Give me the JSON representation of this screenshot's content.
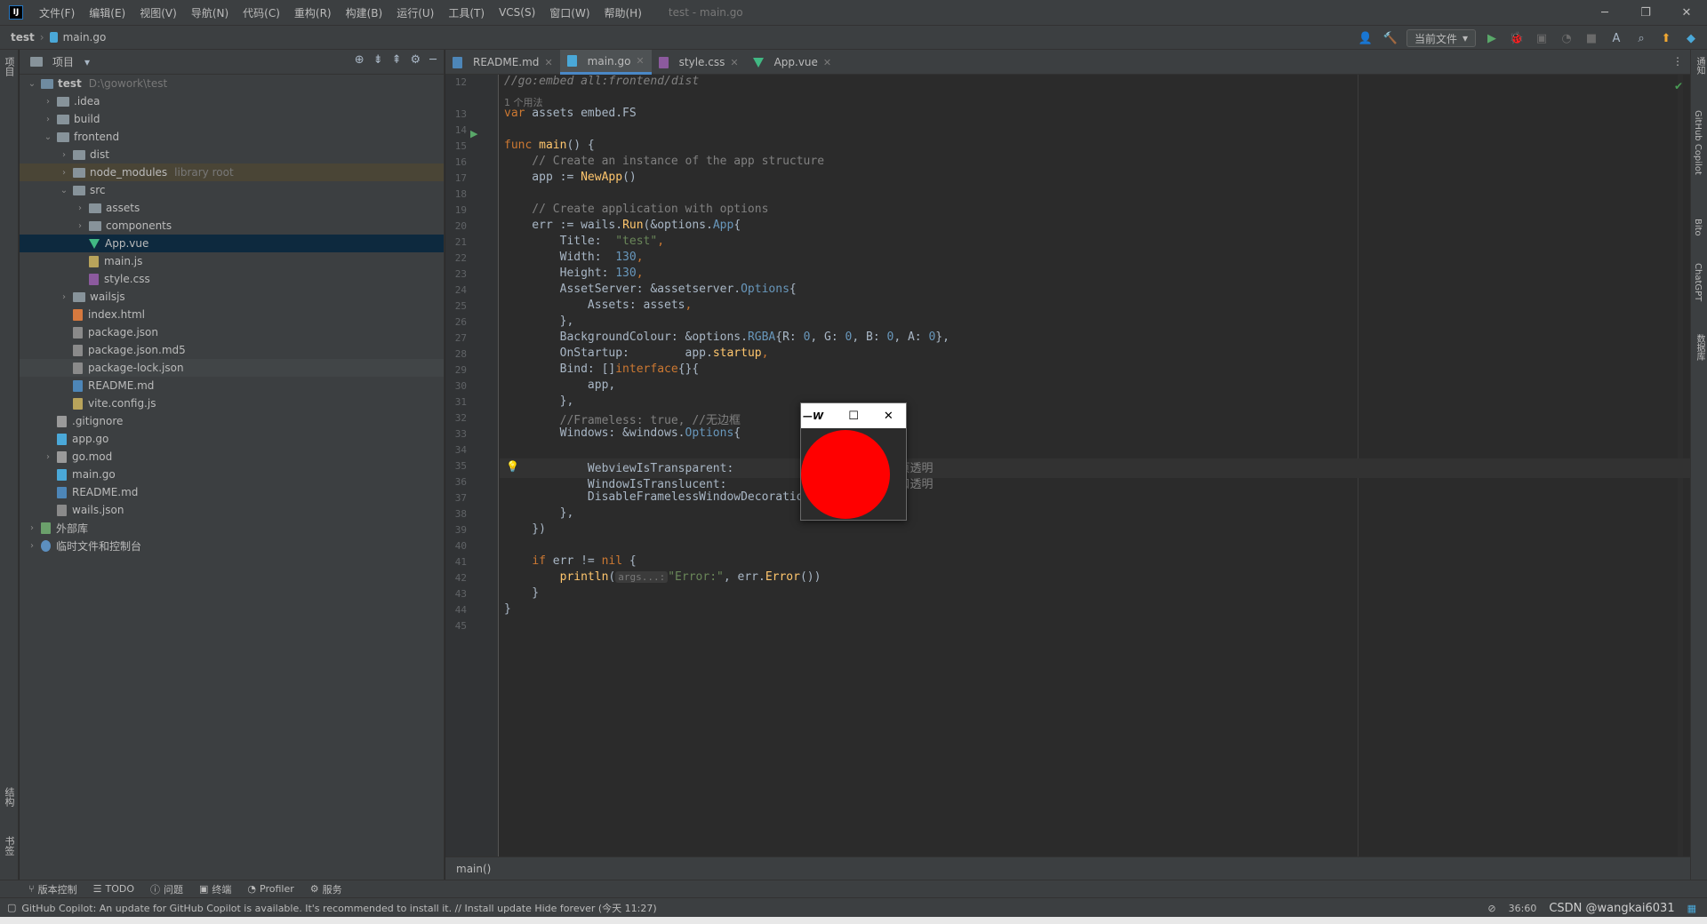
{
  "window": {
    "title": "test - main.go",
    "menu": [
      "文件(F)",
      "编辑(E)",
      "视图(V)",
      "导航(N)",
      "代码(C)",
      "重构(R)",
      "构建(B)",
      "运行(U)",
      "工具(T)",
      "VCS(S)",
      "窗口(W)",
      "帮助(H)"
    ],
    "logo": "IJ"
  },
  "navbar": {
    "project": "test",
    "file": "main.go",
    "run_config": "当前文件"
  },
  "left_strip": {
    "top_label": "项目",
    "bottom_labels": [
      "结构",
      "书签"
    ]
  },
  "project_panel": {
    "title": "项目",
    "tree": [
      {
        "label": "test",
        "hint": "D:\\gowork\\test",
        "type": "folder-root",
        "chev": "v"
      },
      {
        "label": ".idea",
        "type": "folder",
        "chev": ">"
      },
      {
        "label": "build",
        "type": "folder",
        "chev": ">"
      },
      {
        "label": "frontend",
        "type": "folder",
        "chev": "v"
      },
      {
        "label": "dist",
        "type": "folder",
        "chev": ">"
      },
      {
        "label": "node_modules",
        "hint": "library root",
        "type": "folder",
        "chev": ">"
      },
      {
        "label": "src",
        "type": "folder",
        "chev": "v"
      },
      {
        "label": "assets",
        "type": "folder",
        "chev": ">"
      },
      {
        "label": "components",
        "type": "folder",
        "chev": ">"
      },
      {
        "label": "App.vue",
        "type": "vue",
        "chev": ""
      },
      {
        "label": "main.js",
        "type": "js",
        "chev": ""
      },
      {
        "label": "style.css",
        "type": "css",
        "chev": ""
      },
      {
        "label": "wailsjs",
        "type": "folder",
        "chev": ">"
      },
      {
        "label": "index.html",
        "type": "html",
        "chev": ""
      },
      {
        "label": "package.json",
        "type": "json",
        "chev": ""
      },
      {
        "label": "package.json.md5",
        "type": "json",
        "chev": ""
      },
      {
        "label": "package-lock.json",
        "type": "json",
        "chev": ""
      },
      {
        "label": "README.md",
        "type": "md",
        "chev": ""
      },
      {
        "label": "vite.config.js",
        "type": "js",
        "chev": ""
      },
      {
        "label": ".gitignore",
        "type": "txt",
        "chev": ""
      },
      {
        "label": "app.go",
        "type": "go",
        "chev": ""
      },
      {
        "label": "go.mod",
        "type": "txt",
        "chev": ">"
      },
      {
        "label": "main.go",
        "type": "go",
        "chev": ""
      },
      {
        "label": "README.md",
        "type": "md",
        "chev": ""
      },
      {
        "label": "wails.json",
        "type": "json",
        "chev": ""
      },
      {
        "label": "外部库",
        "type": "lib",
        "chev": ">"
      },
      {
        "label": "临时文件和控制台",
        "type": "scratch",
        "chev": ">"
      }
    ]
  },
  "editor_tabs": [
    {
      "label": "README.md",
      "type": "md"
    },
    {
      "label": "main.go",
      "type": "go",
      "active": true
    },
    {
      "label": "style.css",
      "type": "css"
    },
    {
      "label": "App.vue",
      "type": "vue"
    }
  ],
  "editor": {
    "usage_hint": "1 个用法",
    "inlay_args": "args...:",
    "line_numbers": [
      "12",
      "13",
      "14",
      "15",
      "16",
      "17",
      "18",
      "19",
      "20",
      "21",
      "22",
      "23",
      "24",
      "25",
      "26",
      "27",
      "28",
      "29",
      "30",
      "31",
      "32",
      "33",
      "34",
      "35",
      "36",
      "37",
      "38",
      "39",
      "40",
      "41",
      "42",
      "43",
      "44",
      "45"
    ],
    "code": {
      "l12": "//go:embed all:frontend/dist",
      "l13_kw": "var",
      "l13_rest": " assets embed.FS",
      "l15_kw": "func",
      "l15_fn": " main",
      "l15_rest": "() {",
      "l16": "    // Create an instance of the app structure",
      "l17_a": "    app := ",
      "l17_fn": "NewApp",
      "l17_b": "()",
      "l19": "    // Create application with options",
      "l20_a": "    err := wails.",
      "l20_fn": "Run",
      "l20_b": "(&options.",
      "l20_ty": "App",
      "l20_c": "{",
      "l21_a": "        Title:  ",
      "l21_s": "\"test\"",
      "l22_a": "        Width:  ",
      "l22_n": "130",
      "l23_a": "        Height: ",
      "l23_n": "130",
      "l24_a": "        AssetServer: &assetserver.",
      "l24_ty": "Options",
      "l24_b": "{",
      "l25_a": "            Assets: assets",
      "l26": "        },",
      "l27_a": "        BackgroundColour: &options.",
      "l27_ty": "RGBA",
      "l27_b": "{R: ",
      "l27_n1": "0",
      "l27_c": ", G: ",
      "l27_n2": "0",
      "l27_d": ", B: ",
      "l27_n3": "0",
      "l27_e": ", A: ",
      "l27_n4": "0",
      "l27_f": "},",
      "l28_a": "        OnStartup:        app.",
      "l28_fn": "startup",
      "l29_a": "        Bind: []",
      "l29_kw": "interface",
      "l29_b": "{}{",
      "l30": "            app,",
      "l31": "        },",
      "l32": "        //Frameless: true, //无边框",
      "l33_a": "        Windows: &windows.",
      "l33_ty": "Options",
      "l33_b": "{",
      "l35_a": "            WebviewIsTransparent:              ",
      "l35_kw": "true",
      "l35_cm": " //网页透明",
      "l36_a": "            WindowIsTranslucent:               ",
      "l36_kw": "true",
      "l36_cm": " //窗口透明",
      "l37_a": "            DisableFramelessWindowDecorations: ",
      "l37_kw": "true",
      "l38": "        },",
      "l39": "    })",
      "l41_a": "    ",
      "l41_kw": "if",
      "l41_b": " err != ",
      "l41_kw2": "nil",
      "l41_c": " {",
      "l42_a": "        ",
      "l42_fn": "println",
      "l42_b": "(",
      "l42_s": "\"Error:\"",
      "l42_c": ", err.",
      "l42_fn2": "Error",
      "l42_d": "())",
      "l43": "    }",
      "l44": "}"
    }
  },
  "breadcrumb": "main()",
  "bottom_tabs": [
    "版本控制",
    "TODO",
    "问题",
    "终端",
    "Profiler",
    "服务"
  ],
  "status": {
    "message": "GitHub Copilot: An update for GitHub Copilot is available. It's recommended to install it. // Install update   Hide forever (今天 11:27)",
    "position": "36:60",
    "watermark": "CSDN @wangkai6031"
  },
  "right_strip": [
    "通知",
    "GitHub Copilot",
    "Bito",
    "ChatGPT",
    "数据库"
  ],
  "app_window": {
    "logo": "W"
  }
}
